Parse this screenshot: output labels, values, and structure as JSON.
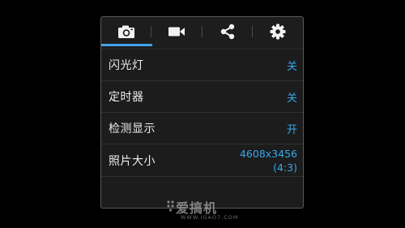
{
  "tabs": [
    {
      "icon": "camera-icon",
      "active": true
    },
    {
      "icon": "video-camera-icon",
      "active": false
    },
    {
      "icon": "share-icon",
      "active": false
    },
    {
      "icon": "gear-icon",
      "active": false
    }
  ],
  "settings": {
    "flash": {
      "label": "闪光灯",
      "value": "关"
    },
    "timer": {
      "label": "定时器",
      "value": "关"
    },
    "detection": {
      "label": "检测显示",
      "value": "开"
    },
    "photo_size": {
      "label": "照片大小",
      "value_line1": "4608x3456",
      "value_line2": "(4:3)"
    }
  },
  "watermark": {
    "main": "爱搞机",
    "sub": "WWW.IGAO7.COM"
  },
  "colors": {
    "accent": "#3fa3e8",
    "value": "#36a8e8",
    "panel_bg": "#1c1c1d",
    "border": "#5a5a5c"
  }
}
